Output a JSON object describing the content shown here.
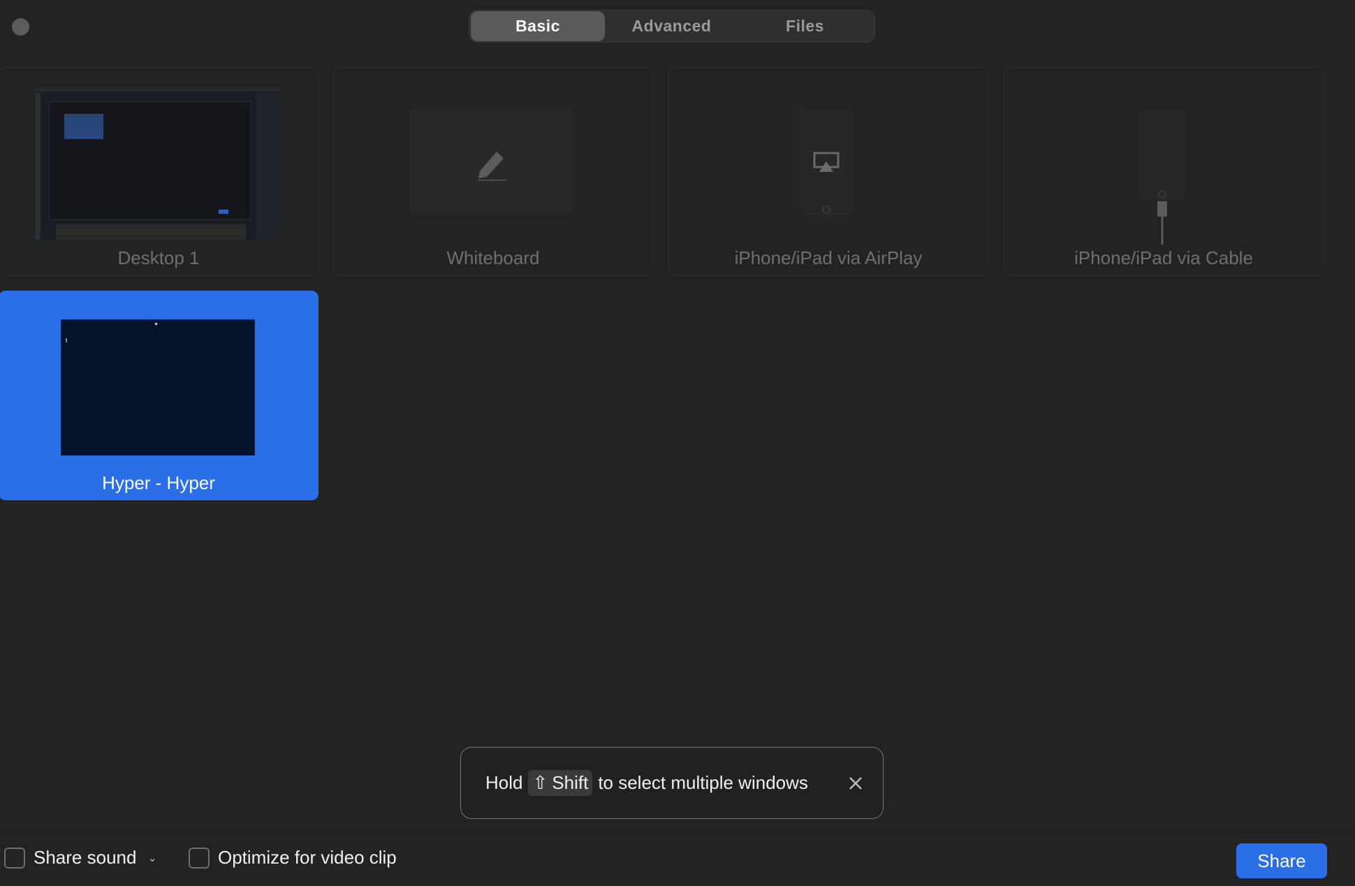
{
  "tabs": [
    {
      "label": "Basic",
      "active": true
    },
    {
      "label": "Advanced",
      "active": false
    },
    {
      "label": "Files",
      "active": false
    }
  ],
  "sources": [
    {
      "label": "Desktop 1",
      "icon": "desktop-thumbnail"
    },
    {
      "label": "Whiteboard",
      "icon": "marker-pen-icon"
    },
    {
      "label": "iPhone/iPad via AirPlay",
      "icon": "airplay-icon"
    },
    {
      "label": "iPhone/iPad via Cable",
      "icon": "cable-icon"
    }
  ],
  "windows": [
    {
      "label": "Hyper - Hyper",
      "selected": true
    }
  ],
  "toast": {
    "prefix": "Hold",
    "key_symbol": "⇧",
    "key_label": "Shift",
    "suffix": "to select multiple windows"
  },
  "footer": {
    "share_sound_label": "Share sound",
    "optimize_label": "Optimize for video clip",
    "share_button": "Share"
  },
  "colors": {
    "accent": "#2a6ee8",
    "background": "#232323"
  }
}
